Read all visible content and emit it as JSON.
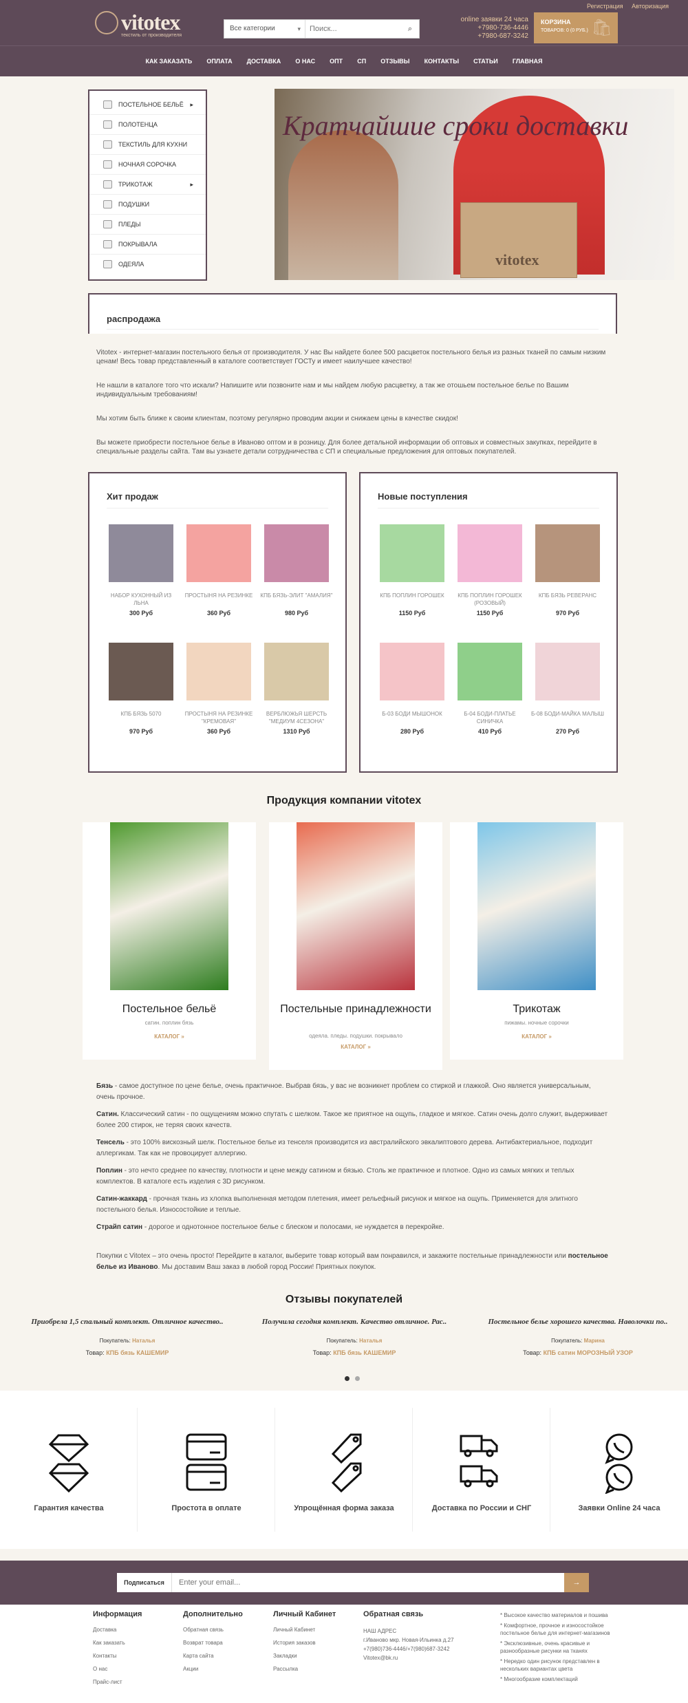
{
  "header": {
    "toplinks": [
      "Регистрация",
      "Авторизация"
    ],
    "logo_text": "vitotex",
    "logo_tagline": "текстиль от производителя",
    "search_category": "Все категории",
    "search_placeholder": "Поиск...",
    "phone_label": "online заявки 24 часа",
    "phone1": "+7980-736-4446",
    "phone2": "+7980-687-3242",
    "cart_title": "КОРЗИНА",
    "cart_sub": "ТОВАРОВ: 0 (0 РУБ.)"
  },
  "nav": [
    "КАК ЗАКАЗАТЬ",
    "ОПЛАТА",
    "ДОСТАВКА",
    "О НАС",
    "ОПТ",
    "СП",
    "ОТЗЫВЫ",
    "КОНТАКТЫ",
    "СТАТЬИ",
    "ГЛАВНАЯ"
  ],
  "categories": [
    {
      "label": "ПОСТЕЛЬНОЕ БЕЛЬЁ",
      "arrow": "▸"
    },
    {
      "label": "ПОЛОТЕНЦА",
      "arrow": ""
    },
    {
      "label": "ТЕКСТИЛЬ ДЛЯ КУХНИ",
      "arrow": ""
    },
    {
      "label": "НОЧНАЯ СОРОЧКА",
      "arrow": ""
    },
    {
      "label": "ТРИКОТАЖ",
      "arrow": "▸"
    },
    {
      "label": "ПОДУШКИ",
      "arrow": ""
    },
    {
      "label": "ПЛЕДЫ",
      "arrow": ""
    },
    {
      "label": "ПОКРЫВАЛА",
      "arrow": ""
    },
    {
      "label": "ОДЕЯЛА",
      "arrow": ""
    }
  ],
  "banner": {
    "slogan": "Кратчайшие сроки доставки",
    "box_logo": "vitotex"
  },
  "sale_title": "распродажа",
  "intro": [
    "Vitotex - интернет-магазин постельного белья от производителя. У нас Вы найдете более 500 расцветок постельного белья из разных тканей по самым низким ценам! Весь товар представленный в каталоге соответствует ГОСТу и имеет наилучшее качество!",
    "Не нашли в каталоге того что искали? Напишите или позвоните нам и мы найдем любую расцветку, а так же отошьем постельное белье по Вашим индивидуальным требованиям!",
    "Мы хотим быть ближе к своим клиентам, поэтому регулярно проводим акции и снижаем цены в качестве скидок!",
    "Вы можете приобрести постельное белье в Иваново оптом и в розницу. Для более детальной информации об оптовых и совместных закупках, перейдите в специальные разделы сайта. Там вы узнаете детали сотрудничества с СП и специальные предложения для оптовых покупателей."
  ],
  "hits": {
    "title": "Хит продаж",
    "items": [
      {
        "name": "НАБОР КУХОННЫЙ ИЗ ЛЬНА",
        "price": "300 Руб",
        "color": "#8f8a9a"
      },
      {
        "name": "ПРОСТЫНЯ НА РЕЗИНКЕ",
        "price": "360 Руб",
        "color": "#f4a3a0"
      },
      {
        "name": "КПБ БЯЗЬ-ЭЛИТ \"АМАЛИЯ\"",
        "price": "980 Руб",
        "color": "#c98aa8"
      },
      {
        "name": "КПБ БЯЗЬ 5070",
        "price": "970 Руб",
        "color": "#6b5a52"
      },
      {
        "name": "ПРОСТЫНЯ НА РЕЗИНКЕ \"КРЕМОВАЯ\"",
        "price": "360 Руб",
        "color": "#f2d6bf"
      },
      {
        "name": "ВЕРБЛЮЖЬЯ ШЕРСТЬ \"МЕДИУМ 4СЕЗОНА\"",
        "price": "1310 Руб",
        "color": "#d9c9a8"
      }
    ]
  },
  "news": {
    "title": "Новые поступления",
    "items": [
      {
        "name": "КПБ ПОПЛИН ГОРОШЕК",
        "price": "1150 Руб",
        "color": "#a7d9a0"
      },
      {
        "name": "КПБ ПОПЛИН ГОРОШЕК (РОЗОВЫЙ)",
        "price": "1150 Руб",
        "color": "#f3b8d6"
      },
      {
        "name": "КПБ БЯЗЬ РЕВЕРАНС",
        "price": "970 Руб",
        "color": "#b6947c"
      },
      {
        "name": "Б-03 БОДИ МЫШОНОК",
        "price": "280 Руб",
        "color": "#f5c4c8"
      },
      {
        "name": "Б-04 БОДИ-ПЛАТЬЕ СИНИЧКА",
        "price": "410 Руб",
        "color": "#8fcf8a"
      },
      {
        "name": "Б-08 БОДИ-МАЙКА МАЛЫШ",
        "price": "270 Руб",
        "color": "#f0d4d8"
      }
    ]
  },
  "products_title": "Продукция компании vitotex",
  "product_cards": [
    {
      "title": "Постельное бельё",
      "sub": "сатин. поплин бязь",
      "link": "КАТАЛОГ »",
      "c1": "#4f9a2f",
      "c2": "#2e7d1f"
    },
    {
      "title": "Постельные принадлежности",
      "sub": "одеяла. пледы. подушки. покрывало",
      "link": "КАТАЛОГ »",
      "c1": "#e86b4f",
      "c2": "#b9333d"
    },
    {
      "title": "Трикотаж",
      "sub": "пижамы. ночные сорочки",
      "link": "КАТАЛОГ »",
      "c1": "#7ec6e8",
      "c2": "#3f8fc6"
    }
  ],
  "descriptions": [
    {
      "term": "Бязь",
      "text": " - самое доступное по цене белье, очень практичное. Выбрав бязь, у вас не возникнет проблем со стиркой и глажкой. Оно является универсальным, очень прочное."
    },
    {
      "term": "Сатин.",
      "text": " Классический сатин - по ощущениям можно спутать с шелком. Такое же приятное на ощупь, гладкое и мягкое. Сатин очень долго служит, выдерживает более 200 стирок, не теряя своих качеств."
    },
    {
      "term": "Тенсель",
      "text": " - это 100% вискозный шелк. Постельное белье из тенселя производится из австралийского эвкалиптового дерева. Антибактериальное, подходит аллергикам. Так как не провоцирует аллергию."
    },
    {
      "term": "Поплин",
      "text": " - это нечто среднее по качеству, плотности и цене между сатином и бязью. Столь же практичное и плотное. Одно из самых мягких и теплых комплектов. В каталоге есть изделия с 3D рисунком."
    },
    {
      "term": "Сатин-жаккард",
      "text": " - прочная ткань из хлопка выполненная методом плетения, имеет рельефный рисунок и мягкое на ощупь. Применяется для элитного постельного белья. Износостойкие и теплые."
    },
    {
      "term": "Страйп сатин",
      "text": " - дорогое и однотонное постельное белье с блеском и полосами, не нуждается в перекройке."
    }
  ],
  "closing_before": "Покупки с Vitotex – это очень просто! Перейдите в каталог, выберите товар который вам понравился, и закажите постельные принадлежности или ",
  "closing_bold": "постельное белье из Иваново",
  "closing_after": ". Мы доставим Ваш заказ в любой город России! Приятных покупок.",
  "reviews_title": "Отзывы покупателей",
  "reviews": [
    {
      "quote": "Приобрела 1,5 спальный комплект. Отличное качество..",
      "buyer_label": "Покупатель:",
      "buyer": "Наталья",
      "product_label": "Товар:",
      "product": "КПБ бязь КАШЕМИР"
    },
    {
      "quote": "Получила сегодня комплект. Качество отличное. Рас..",
      "buyer_label": "Покупатель:",
      "buyer": "Наталья",
      "product_label": "Товар:",
      "product": "КПБ бязь КАШЕМИР"
    },
    {
      "quote": "Постельное белье хорошего качества. Наволочки по..",
      "buyer_label": "Покупатель:",
      "buyer": "Марина",
      "product_label": "Товар:",
      "product": "КПБ сатин МОРОЗНЫЙ УЗОР"
    }
  ],
  "features": [
    {
      "label": "Гарантия качества",
      "icon": "diamond-icon"
    },
    {
      "label": "Простота в оплате",
      "icon": "credit-card-icon"
    },
    {
      "label": "Упрощённая форма заказа",
      "icon": "tag-icon"
    },
    {
      "label": "Доставка по России и СНГ",
      "icon": "truck-icon"
    },
    {
      "label": "Заявки Online 24 часа",
      "icon": "whatsapp-icon"
    }
  ],
  "subscribe": {
    "label": "Подписаться",
    "placeholder": "Enter your email...",
    "button": "→"
  },
  "footer": {
    "info": {
      "title": "Информация",
      "links": [
        "Доставка",
        "Как заказать",
        "Контакты",
        "О нас",
        "Прайс-лист"
      ]
    },
    "extra": {
      "title": "Дополнительно",
      "links": [
        "Обратная связь",
        "Возврат товара",
        "Карта сайта",
        "Акции"
      ]
    },
    "account": {
      "title": "Личный Кабинет",
      "links": [
        "Личный Кабинет",
        "История заказов",
        "Закладки",
        "Рассылка"
      ]
    },
    "contact": {
      "title": "Обратная связь",
      "lines": [
        "НАШ АДРЕС",
        "г.Иваново мкр. Новая-Ильинка д.27",
        "+7(980)736-4446/+7(980)687-3242",
        "Vitotex@bk.ru"
      ]
    },
    "notes": [
      "* Высокое качество материалов и пошива",
      "* Комфортное, прочное и износостойкое постельное белье для интернет-магазинов",
      "* Эксклюзивные, очень красивые и разнообразные рисунки на тканях",
      "* Нередко один рисунок представлен в нескольких вариантах цвета",
      "* Многообразие комплектаций"
    ]
  },
  "colors": {
    "brand": "#5e4a58",
    "accent": "#c69a66"
  }
}
